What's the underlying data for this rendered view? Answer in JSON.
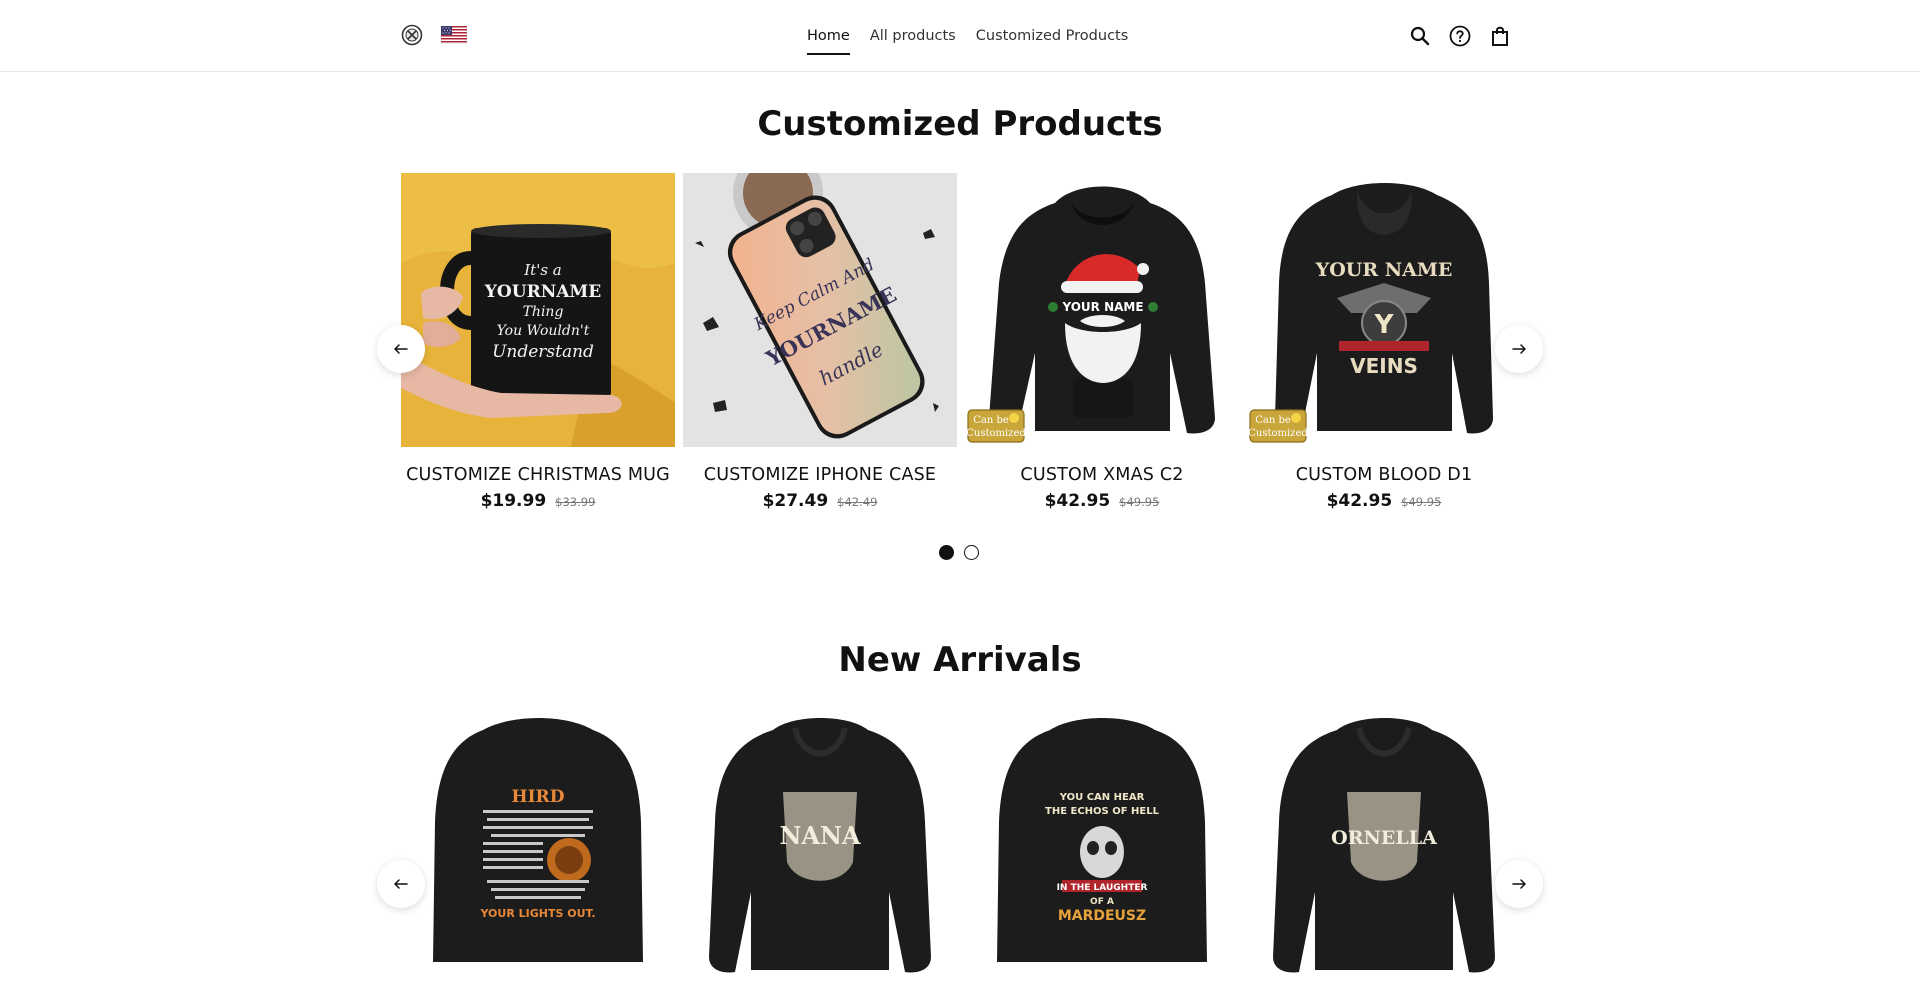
{
  "header": {
    "nav": [
      {
        "label": "Home",
        "active": true
      },
      {
        "label": "All products",
        "active": false
      },
      {
        "label": "Customized Products",
        "active": false
      }
    ],
    "icons": [
      "logo-icon",
      "us-flag-icon",
      "search-icon",
      "help-icon",
      "shopping-bag-icon"
    ]
  },
  "customized": {
    "title": "Customized Products",
    "products": [
      {
        "name": "CUSTOMIZE CHRISTMAS MUG",
        "price": "$19.99",
        "old_price": "$33.99",
        "print_lines": [
          "It's a",
          "YOURNAME",
          "Thing",
          "You Wouldn't",
          "Understand"
        ],
        "badge": false
      },
      {
        "name": "CUSTOMIZE IPHONE CASE",
        "price": "$27.49",
        "old_price": "$42.49",
        "print_lines": [
          "Keep Calm And",
          "YOURNAME",
          "handle"
        ],
        "badge": false
      },
      {
        "name": "CUSTOM XMAS C2",
        "price": "$42.95",
        "old_price": "$49.95",
        "print_lines": [
          "YOUR NAME"
        ],
        "badge": true
      },
      {
        "name": "CUSTOM BLOOD D1",
        "price": "$42.95",
        "old_price": "$49.95",
        "print_lines": [
          "YOUR NAME",
          "Y",
          "VEINS"
        ],
        "badge": true
      }
    ],
    "badge_lines": [
      "Can be",
      "Customized"
    ],
    "pagination": {
      "pages": 2,
      "current": 1
    }
  },
  "arrivals": {
    "title": "New Arrivals",
    "products": [
      {
        "print_lines": [
          "HIRD",
          "YOUR LIGHTS OUT."
        ]
      },
      {
        "print_lines": [
          "NANA"
        ]
      },
      {
        "print_lines": [
          "YOU CAN HEAR",
          "THE ECHOS OF HELL",
          "IN THE LAUGHTER",
          "OF A",
          "MARDEUSZ"
        ]
      },
      {
        "print_lines": [
          "ORNELLA"
        ]
      }
    ]
  },
  "colors": {
    "accent": "#111111",
    "mug_background": "#e8b33a",
    "hoodie": "#1c1c1c",
    "case_gradient_start": "#e8b8a0",
    "case_gradient_end": "#c8c8b0"
  }
}
